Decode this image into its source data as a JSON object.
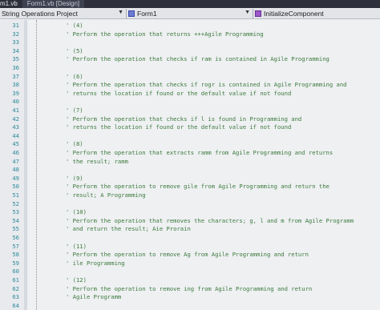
{
  "tabs": [
    {
      "label": "m1.vb"
    },
    {
      "label": "Form1.vb [Design]"
    }
  ],
  "nav": {
    "project": "String Operations Project",
    "class": "Form1",
    "member": "InitializeComponent"
  },
  "colors": {
    "comment": "#3d7a3d",
    "line_number": "#2c8a9a",
    "tab_bar": "#2d2f3a",
    "editor_bg": "#eef0f2"
  },
  "editor": {
    "lines": [
      {
        "num": "31",
        "text": "' (4)"
      },
      {
        "num": "32",
        "text": "' Perform the operation that returns +++Agile Programming"
      },
      {
        "num": "33",
        "text": ""
      },
      {
        "num": "34",
        "text": "' (5)"
      },
      {
        "num": "35",
        "text": "' Perform the operation that checks if ram is contained in Agile Programming"
      },
      {
        "num": "36",
        "text": ""
      },
      {
        "num": "37",
        "text": "' (6)"
      },
      {
        "num": "38",
        "text": "' Perform the operation that checks if rogr is contained in Agile Programming and"
      },
      {
        "num": "39",
        "text": "' returns the location if found or the default value if not found"
      },
      {
        "num": "40",
        "text": ""
      },
      {
        "num": "41",
        "text": "' (7)"
      },
      {
        "num": "42",
        "text": "' Perform the operation that checks if l is found in Programming and"
      },
      {
        "num": "43",
        "text": "' returns the location if found or the default value if not found"
      },
      {
        "num": "44",
        "text": ""
      },
      {
        "num": "45",
        "text": "' (8)"
      },
      {
        "num": "46",
        "text": "' Perform the operation that extracts ramm from Agile Programming and returns"
      },
      {
        "num": "47",
        "text": "' the result; ramm"
      },
      {
        "num": "48",
        "text": ""
      },
      {
        "num": "49",
        "text": "' (9)"
      },
      {
        "num": "50",
        "text": "' Perform the operation to remove gile from Agile Programming and return the"
      },
      {
        "num": "51",
        "text": "' result; A Programming"
      },
      {
        "num": "52",
        "text": ""
      },
      {
        "num": "53",
        "text": "' (10)"
      },
      {
        "num": "54",
        "text": "' Perform the operation that removes the characters; g, l and m from Agile Programm"
      },
      {
        "num": "55",
        "text": "' and return the result; Aie Prorain"
      },
      {
        "num": "56",
        "text": ""
      },
      {
        "num": "57",
        "text": "' (11)"
      },
      {
        "num": "58",
        "text": "' Perform the operation to remove Ag from Agile Programming and return"
      },
      {
        "num": "59",
        "text": "' ile Programming"
      },
      {
        "num": "60",
        "text": ""
      },
      {
        "num": "61",
        "text": "' (12)"
      },
      {
        "num": "62",
        "text": "' Perform the operation to remove ing from Agile Programming and return"
      },
      {
        "num": "63",
        "text": "' Agile Programm"
      },
      {
        "num": "64",
        "text": ""
      }
    ]
  }
}
